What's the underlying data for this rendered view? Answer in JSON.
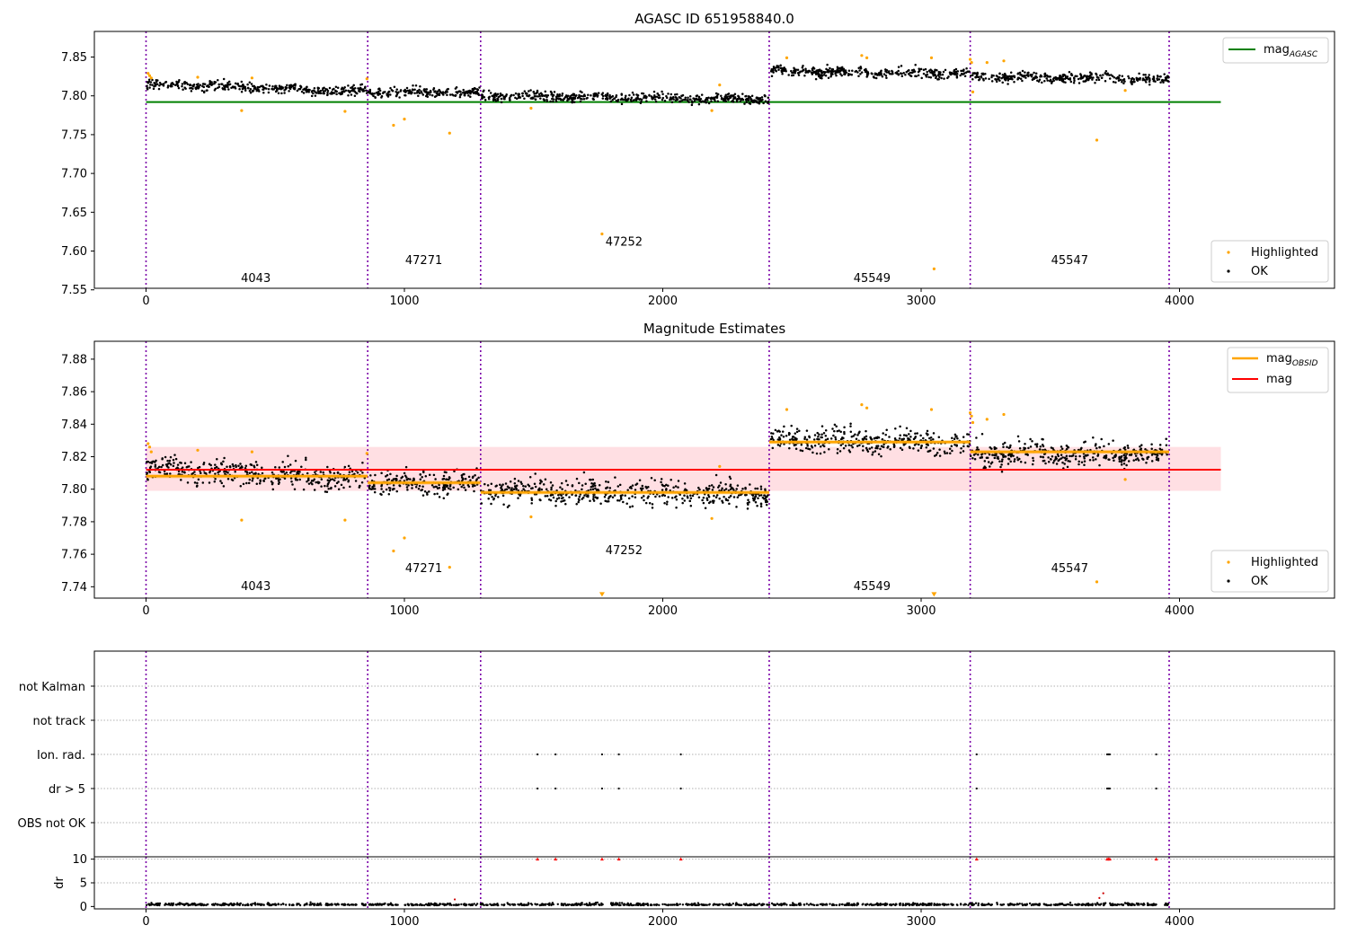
{
  "chart_data": [
    {
      "type": "scatter",
      "title": "AGASC ID 651958840.0",
      "xlim": [
        -200,
        4600
      ],
      "ylim": [
        7.552,
        7.883
      ],
      "xticks": [
        0,
        1000,
        2000,
        3000,
        4000
      ],
      "yticks": [
        7.55,
        7.6,
        7.65,
        7.7,
        7.75,
        7.8,
        7.85
      ],
      "ytick_labels": [
        "7.55",
        "7.60",
        "7.65",
        "7.70",
        "7.75",
        "7.80",
        "7.85"
      ],
      "grid": false,
      "obs_boundaries": [
        0,
        858,
        1295,
        2412,
        3190,
        3960
      ],
      "obs_labels": [
        {
          "x": 425,
          "y": 7.56,
          "text": "4043"
        },
        {
          "x": 1075,
          "y": 7.583,
          "text": "47271"
        },
        {
          "x": 1850,
          "y": 7.607,
          "text": "47252"
        },
        {
          "x": 2810,
          "y": 7.56,
          "text": "45549"
        },
        {
          "x": 3575,
          "y": 7.583,
          "text": "45547"
        }
      ],
      "lines": [
        {
          "name": "mag_AGASC",
          "x": [
            0,
            4160
          ],
          "y": [
            7.792,
            7.792
          ],
          "color": "#008000"
        }
      ],
      "ok_levels": [
        {
          "x0": 0,
          "x1": 858,
          "y0": 7.815,
          "y1": 7.806
        },
        {
          "x0": 858,
          "x1": 1295,
          "y0": 7.804,
          "y1": 7.804
        },
        {
          "x0": 1295,
          "x1": 2412,
          "y0": 7.8,
          "y1": 7.796
        },
        {
          "x0": 2412,
          "x1": 3190,
          "y0": 7.832,
          "y1": 7.829
        },
        {
          "x0": 3190,
          "x1": 3960,
          "y0": 7.825,
          "y1": 7.821
        }
      ],
      "ok_noise": 0.0045,
      "highlighted": {
        "x": [
          8,
          14,
          20,
          200,
          370,
          410,
          770,
          855,
          958,
          1000,
          1175,
          1490,
          1765,
          2190,
          2220,
          2480,
          2770,
          2790,
          3040,
          3050,
          3190,
          3195,
          3200,
          3255,
          3320,
          3680,
          3790
        ],
        "y": [
          7.829,
          7.826,
          7.823,
          7.824,
          7.781,
          7.823,
          7.78,
          7.822,
          7.762,
          7.77,
          7.752,
          7.784,
          7.622,
          7.781,
          7.814,
          7.849,
          7.852,
          7.849,
          7.849,
          7.577,
          7.847,
          7.843,
          7.805,
          7.843,
          7.845,
          7.743,
          7.807
        ]
      },
      "legends": [
        {
          "position": "top-right",
          "entries": [
            {
              "name": "mag_AGASC",
              "kind": "line",
              "color": "#008000",
              "label": "mag",
              "sub": "AGASC"
            }
          ]
        },
        {
          "position": "bottom-right",
          "entries": [
            {
              "name": "Highlighted",
              "kind": "dot",
              "color": "#ffa500",
              "label": "Highlighted"
            },
            {
              "name": "OK",
              "kind": "dot",
              "color": "#000000",
              "label": "OK"
            }
          ]
        }
      ]
    },
    {
      "type": "scatter",
      "title": "Magnitude Estimates",
      "xlim": [
        -200,
        4600
      ],
      "ylim": [
        7.733,
        7.891
      ],
      "xticks": [
        0,
        1000,
        2000,
        3000,
        4000
      ],
      "yticks": [
        7.74,
        7.76,
        7.78,
        7.8,
        7.82,
        7.84,
        7.86,
        7.88
      ],
      "ytick_labels": [
        "7.74",
        "7.76",
        "7.78",
        "7.80",
        "7.82",
        "7.84",
        "7.86",
        "7.88"
      ],
      "grid": false,
      "obs_boundaries": [
        0,
        858,
        1295,
        2412,
        3190,
        3960
      ],
      "obs_labels": [
        {
          "x": 425,
          "y": 7.738,
          "text": "4043"
        },
        {
          "x": 1075,
          "y": 7.749,
          "text": "47271"
        },
        {
          "x": 1850,
          "y": 7.76,
          "text": "47252"
        },
        {
          "x": 2810,
          "y": 7.738,
          "text": "45549"
        },
        {
          "x": 3575,
          "y": 7.749,
          "text": "45547"
        }
      ],
      "band": {
        "x": [
          0,
          4160
        ],
        "y0": 7.799,
        "y1": 7.826,
        "color": "#ffc0c8"
      },
      "lines": [
        {
          "name": "mag",
          "x": [
            0,
            4160
          ],
          "y": [
            7.812,
            7.812
          ],
          "color": "#ff0000"
        }
      ],
      "obsid_mag": [
        {
          "x0": 0,
          "x1": 858,
          "y": 7.808
        },
        {
          "x0": 858,
          "x1": 1295,
          "y": 7.804
        },
        {
          "x0": 1295,
          "x1": 2412,
          "y": 7.798
        },
        {
          "x0": 2412,
          "x1": 3190,
          "y": 7.829
        },
        {
          "x0": 3190,
          "x1": 3960,
          "y": 7.823
        }
      ],
      "ok_levels": [
        {
          "x0": 0,
          "x1": 858,
          "y0": 7.813,
          "y1": 7.806
        },
        {
          "x0": 858,
          "x1": 1295,
          "y0": 7.804,
          "y1": 7.804
        },
        {
          "x0": 1295,
          "x1": 2412,
          "y0": 7.799,
          "y1": 7.797
        },
        {
          "x0": 2412,
          "x1": 3190,
          "y0": 7.831,
          "y1": 7.828
        },
        {
          "x0": 3190,
          "x1": 3960,
          "y0": 7.823,
          "y1": 7.821
        }
      ],
      "ok_noise": 0.0055,
      "highlighted": {
        "x": [
          8,
          14,
          20,
          200,
          370,
          410,
          770,
          855,
          958,
          1000,
          1175,
          1490,
          2190,
          2220,
          2480,
          2770,
          2790,
          3040,
          3190,
          3195,
          3200,
          3255,
          3320,
          3680,
          3790
        ],
        "y": [
          7.828,
          7.826,
          7.823,
          7.824,
          7.781,
          7.823,
          7.781,
          7.822,
          7.762,
          7.77,
          7.752,
          7.783,
          7.782,
          7.814,
          7.849,
          7.852,
          7.85,
          7.849,
          7.847,
          7.845,
          7.841,
          7.843,
          7.846,
          7.743,
          7.806
        ]
      },
      "off_scale": {
        "x": [
          1765,
          3050
        ],
        "y": [
          7.735,
          7.735
        ]
      },
      "legends": [
        {
          "position": "top-right",
          "entries": [
            {
              "name": "mag_OBSID",
              "kind": "line",
              "color": "#ffa500",
              "label": "mag",
              "sub": "OBSID"
            },
            {
              "name": "mag",
              "kind": "line",
              "color": "#ff0000",
              "label": "mag",
              "sub": ""
            }
          ]
        },
        {
          "position": "bottom-right",
          "entries": [
            {
              "name": "Highlighted",
              "kind": "dot",
              "color": "#ffa500",
              "label": "Highlighted"
            },
            {
              "name": "OK",
              "kind": "dot",
              "color": "#000000",
              "label": "OK"
            }
          ]
        }
      ]
    },
    {
      "type": "scatter",
      "title": "",
      "xlim": [
        -200,
        4600
      ],
      "categories": [
        "not Kalman",
        "not track",
        "Ion. rad.",
        "dr > 5",
        "OBS not OK"
      ],
      "grid": true,
      "obs_boundaries": [
        0,
        858,
        1295,
        2412,
        3190,
        3960
      ],
      "flags": [
        {
          "category": "Ion. rad.",
          "x": [
            1515,
            1585,
            1765,
            1830,
            2070,
            3215,
            3720,
            3725,
            3730,
            3910
          ]
        },
        {
          "category": "dr > 5",
          "x": [
            1515,
            1585,
            1765,
            1830,
            2070,
            3215,
            3720,
            3725,
            3730,
            3910
          ]
        }
      ]
    },
    {
      "type": "scatter",
      "title": "",
      "ylabel": "dr",
      "xlim": [
        -200,
        4600
      ],
      "ylim": [
        -0.5,
        10.5
      ],
      "xticks": [
        0,
        1000,
        2000,
        3000,
        4000
      ],
      "yticks": [
        0,
        5,
        10
      ],
      "ytick_labels": [
        "0",
        "5",
        "10"
      ],
      "grid": true,
      "obs_boundaries": [
        0,
        858,
        1295,
        2412,
        3190,
        3960
      ],
      "dr_baseline": 0.25,
      "dr_noise": 0.35,
      "dr_extra": {
        "x": [
          3705,
          3690,
          1195
        ],
        "y": [
          2.8,
          1.8,
          1.5
        ]
      },
      "clipped": {
        "x": [
          1515,
          1585,
          1765,
          1830,
          2070,
          3215,
          3720,
          3725,
          3730,
          3910
        ],
        "y": [
          10,
          10,
          10,
          10,
          10,
          10,
          10,
          10,
          10,
          10
        ]
      }
    }
  ]
}
